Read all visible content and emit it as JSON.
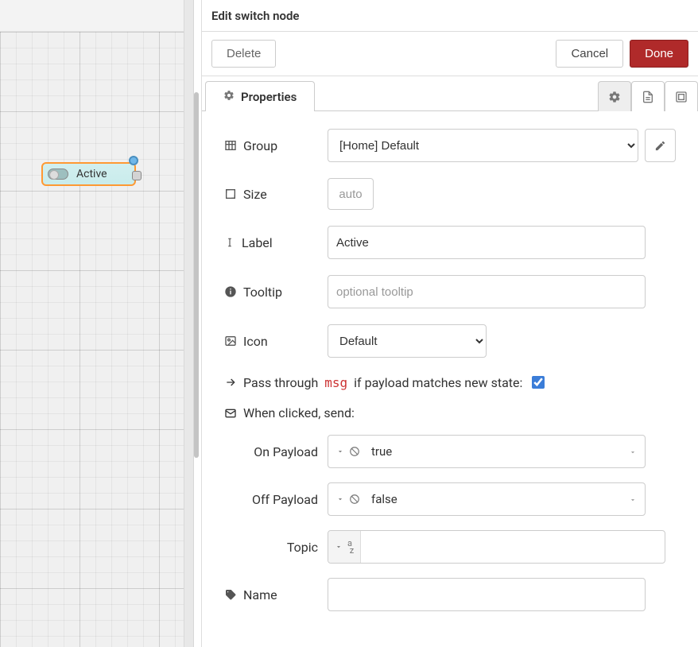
{
  "node_canvas": {
    "label": "Active"
  },
  "header": {
    "title": "Edit switch node"
  },
  "actions": {
    "delete": "Delete",
    "cancel": "Cancel",
    "done": "Done"
  },
  "tabs": {
    "properties": "Properties"
  },
  "form": {
    "group": {
      "label": "Group",
      "value": "[Home] Default"
    },
    "size": {
      "label": "Size",
      "value": "auto"
    },
    "label_field": {
      "label": "Label",
      "value": "Active"
    },
    "tooltip": {
      "label": "Tooltip",
      "placeholder": "optional tooltip",
      "value": ""
    },
    "icon": {
      "label": "Icon",
      "value": "Default"
    },
    "passthrough": {
      "pre": "Pass through",
      "code": "msg",
      "post": "if payload matches new state:",
      "checked": true
    },
    "when_clicked": "When clicked, send:",
    "on_payload": {
      "label": "On Payload",
      "value": "true"
    },
    "off_payload": {
      "label": "Off Payload",
      "value": "false"
    },
    "topic": {
      "label": "Topic",
      "value": ""
    },
    "name": {
      "label": "Name",
      "value": ""
    }
  }
}
